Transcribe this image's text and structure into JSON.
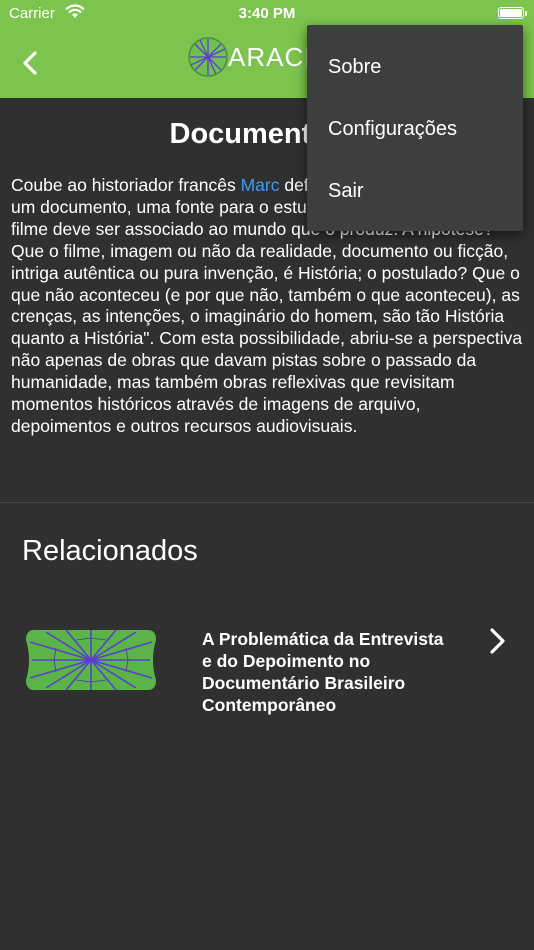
{
  "status_bar": {
    "carrier": "Carrier",
    "time": "3:40 PM"
  },
  "nav": {
    "brand": "ARACI."
  },
  "article": {
    "title": "Documentário",
    "text_before_link": "Coube ao historiador francês ",
    "link_text": "Marc",
    "text_after_link": " definitivamente o filme como um documento, uma fonte para o estudo da história. Para ele, \"o filme deve ser associado ao mundo que o produz. A hipótese? Que o filme, imagem ou não da realidade, documento ou ficção, intriga autêntica ou pura invenção, é História; o postulado? Que o que não aconteceu (e por que não, também o que aconteceu), as crenças, as intenções, o imaginário do homem, são tão História quanto a História\". Com esta possibilidade, abriu-se a perspectiva não apenas de obras que davam pistas sobre o passado da humanidade, mas também obras reflexivas que revisitam momentos históricos através de imagens de arquivo, depoimentos e outros recursos audiovisuais."
  },
  "related": {
    "title": "Relacionados",
    "items": [
      {
        "title": "A Problemática da Entrevista e do Depoimento no Documentário Brasileiro Contemporâneo"
      }
    ]
  },
  "menu": {
    "items": [
      {
        "label": "Sobre"
      },
      {
        "label": "Configurações"
      },
      {
        "label": "Sair"
      }
    ]
  },
  "colors": {
    "header": "#7cc44e",
    "background": "#303030",
    "menu_background": "#3e3e3e",
    "link": "#3b9bf5",
    "leaf_green": "#5ab448",
    "leaf_vein": "#5b3fd0"
  },
  "icons": {
    "back": "chevron-left-icon",
    "wifi": "wifi-icon",
    "battery": "battery-icon",
    "related_arrow": "chevron-right-icon"
  }
}
